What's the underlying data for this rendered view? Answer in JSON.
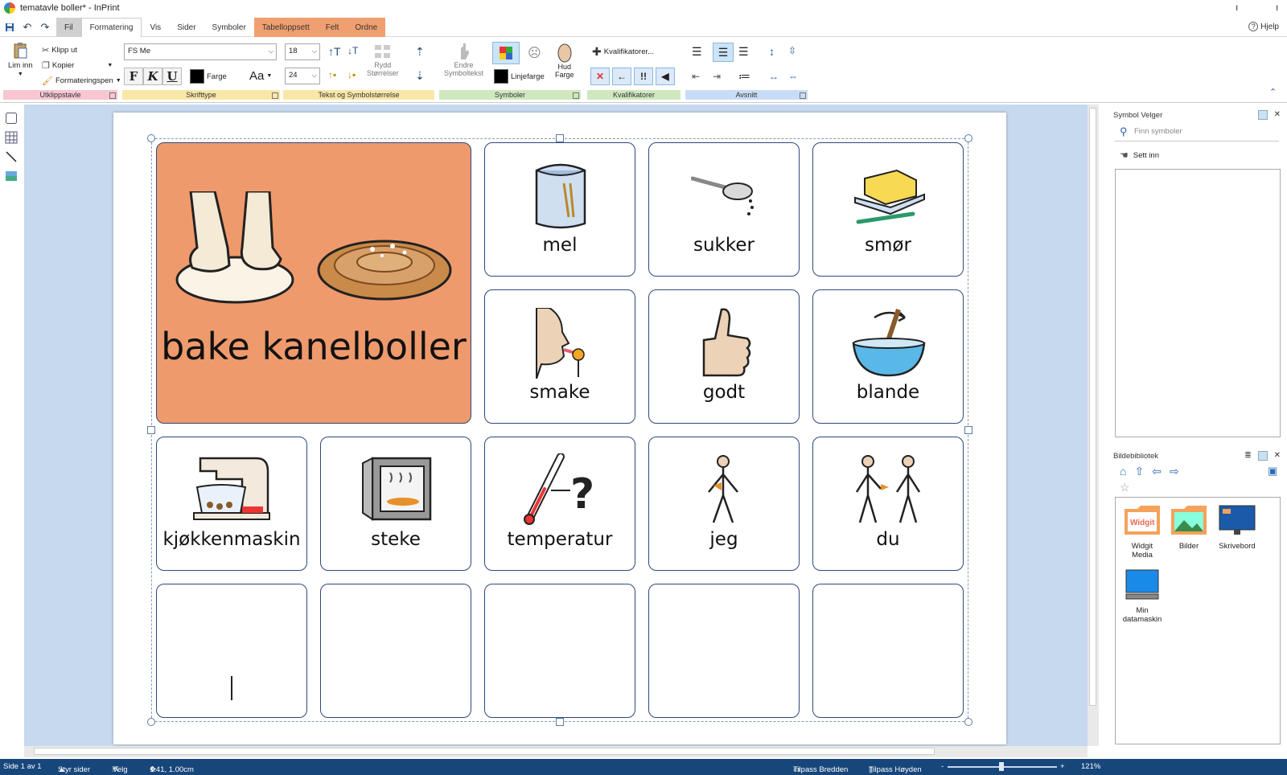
{
  "window": {
    "title": "tematavle boller* - InPrint",
    "minimize": "ı",
    "close": "ı"
  },
  "tabs": [
    {
      "label": "Fil"
    },
    {
      "label": "Formatering"
    },
    {
      "label": "Vis"
    },
    {
      "label": "Sider"
    },
    {
      "label": "Symboler"
    },
    {
      "label": "Tabelloppsett"
    },
    {
      "label": "Felt"
    },
    {
      "label": "Ordne"
    }
  ],
  "help": "Hjelp",
  "ribbon": {
    "clipboard": {
      "paste": "Lim inn",
      "cut": "Klipp ut",
      "copy": "Kopier",
      "format_painter": "Formateringspen",
      "group": "Utklippstavle"
    },
    "font": {
      "family": "FS Me",
      "color": "Farge",
      "case": "Aa",
      "bold": "F",
      "italic": "K",
      "underline": "U",
      "group": "Skrifttype"
    },
    "sizes": {
      "text_size": "18",
      "symbol_size": "24",
      "tidy_line1": "Rydd",
      "tidy_line2": "Størrelser",
      "group": "Tekst og Symbolstørrelse"
    },
    "symbols": {
      "edit_line1": "Endre",
      "edit_line2": "Symboltekst",
      "line_color": "Linjefarge",
      "skin_line1": "Hud",
      "skin_line2": "Farge",
      "group": "Symboler"
    },
    "qualifiers": {
      "button": "Kvalifikatorer...",
      "group": "Kvalifikatorer"
    },
    "paragraph": {
      "group": "Avsnitt"
    }
  },
  "board": {
    "title": "bake kanelboller",
    "cells": [
      {
        "word": "mel",
        "icon": "flour-bag-icon"
      },
      {
        "word": "sukker",
        "icon": "sugar-spoon-icon"
      },
      {
        "word": "smør",
        "icon": "butter-icon"
      },
      {
        "word": "smake",
        "icon": "taste-icon"
      },
      {
        "word": "godt",
        "icon": "thumbs-up-icon"
      },
      {
        "word": "blande",
        "icon": "mixing-bowl-icon"
      },
      {
        "word": "kjøkkenmaskin",
        "icon": "stand-mixer-icon"
      },
      {
        "word": "steke",
        "icon": "oven-icon"
      },
      {
        "word": "temperatur",
        "icon": "thermometer-question-icon"
      },
      {
        "word": "jeg",
        "icon": "person-me-icon"
      },
      {
        "word": "du",
        "icon": "person-you-icon"
      }
    ],
    "accent": "#ef9a6c",
    "border": "#2e4a78"
  },
  "symbol_panel": {
    "title": "Symbol Velger",
    "search_placeholder": "Finn symboler",
    "insert": "Sett inn"
  },
  "image_panel": {
    "title": "Bildebibliotek",
    "folders": [
      {
        "line1": "Widgit",
        "line2": "Media",
        "badge": "Widgit"
      },
      {
        "line1": "Bilder",
        "line2": ""
      },
      {
        "line1": "Skrivebord",
        "line2": ""
      },
      {
        "line1": "Min",
        "line2": "datamaskin"
      }
    ]
  },
  "status": {
    "page": "Side 1 av 1",
    "manage": "Styr sider",
    "select": "Velg",
    "coords": "1.41, 1.00cm",
    "fit_width": "Tilpass Bredden",
    "fit_height": "Tilpass Høyden",
    "zoom_minus": "-",
    "zoom_plus": "+",
    "zoom": "121%",
    "zoom_level_fraction": 0.49
  }
}
